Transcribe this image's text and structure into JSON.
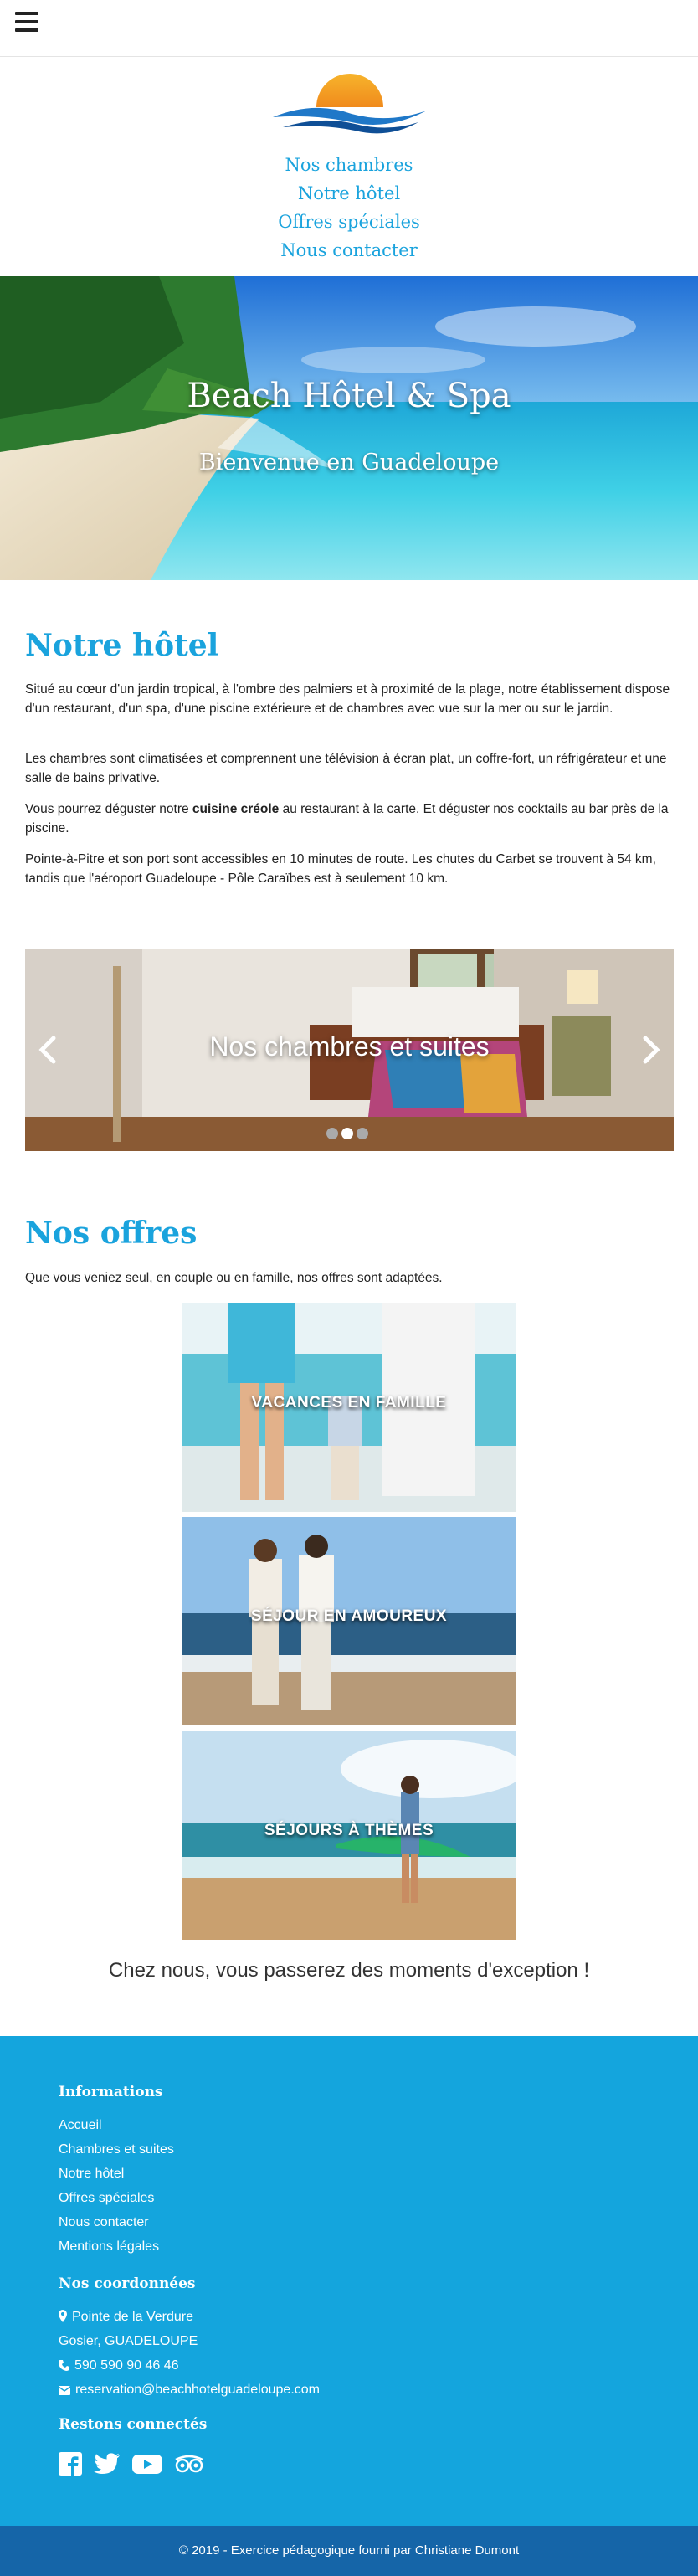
{
  "header": {
    "menu_icon": "hamburger-menu-icon"
  },
  "logo": {
    "icon": "sunset-waves-logo"
  },
  "nav": {
    "items": [
      {
        "label": "Nos chambres"
      },
      {
        "label": "Notre hôtel"
      },
      {
        "label": "Offres spéciales"
      },
      {
        "label": "Nous contacter"
      }
    ]
  },
  "hero": {
    "title": "Beach Hôtel & Spa",
    "subtitle": "Bienvenue en Guadeloupe"
  },
  "hotel": {
    "heading": "Notre hôtel",
    "p1": "Situé au cœur d'un jardin tropical, à l'ombre des palmiers et à proximité de la plage, notre établissement dispose d'un restaurant, d'un spa, d'une piscine extérieure et de chambres avec vue sur la mer ou sur le jardin.",
    "p2": "Les chambres sont climatisées et comprennent une télévision à écran plat, un coffre-fort, un réfrigérateur et une salle de bains privative.",
    "p3_before": "Vous pourrez déguster notre ",
    "p3_bold": "cuisine créole",
    "p3_after": " au restaurant à la carte. Et déguster nos cocktails au bar près de la piscine.",
    "p4": "Pointe-à-Pitre et son port sont accessibles en 10 minutes de route. Les chutes du Carbet se trouvent à 54 km, tandis que l'aéroport Guadeloupe - Pôle Caraïbes est à seulement 10 km."
  },
  "carousel": {
    "caption": "Nos chambres et suites",
    "prev_icon": "chevron-left-icon",
    "next_icon": "chevron-right-icon",
    "slide_count": 3,
    "active_slide": 1
  },
  "offers": {
    "heading": "Nos offres",
    "intro": "Que vous veniez seul, en couple ou en famille, nos offres sont adaptées.",
    "items": [
      {
        "label": "VACANCES EN FAMILLE"
      },
      {
        "label": "SÉJOUR EN AMOUREUX"
      },
      {
        "label": "SÉJOURS À THÈMES"
      }
    ],
    "tagline": "Chez nous, vous passerez des moments d'exception !"
  },
  "footer": {
    "info_heading": "Informations",
    "links": [
      {
        "label": "Accueil"
      },
      {
        "label": "Chambres et suites"
      },
      {
        "label": "Notre hôtel"
      },
      {
        "label": "Offres spéciales"
      },
      {
        "label": "Nous contacter"
      },
      {
        "label": "Mentions légales"
      }
    ],
    "contact_heading": "Nos coordonnées",
    "address_line1": "Pointe de la Verdure",
    "address_line2": "Gosier, GUADELOUPE",
    "phone": "590 590 90 46 46",
    "email": "reservation@beachhotelguadeloupe.com",
    "social_heading": "Restons connectés",
    "social": [
      "facebook-icon",
      "twitter-icon",
      "youtube-icon",
      "tripadvisor-icon"
    ],
    "copyright": "© 2019 - Exercice pédagogique fourni par Christiane Dumont"
  },
  "colors": {
    "accent": "#1aa3dd",
    "footer_bg": "#14a5dd",
    "copyright_bg": "#1565a8"
  }
}
